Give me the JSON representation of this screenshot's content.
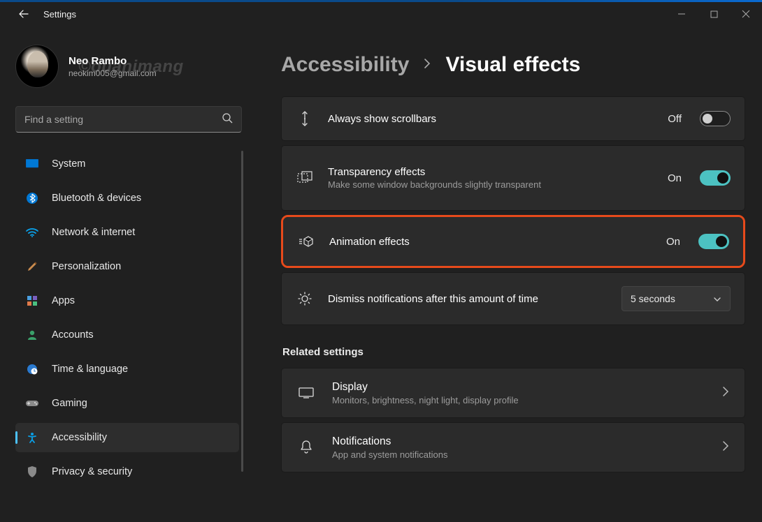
{
  "window": {
    "app_title": "Settings"
  },
  "profile": {
    "name": "Neo Rambo",
    "email": "neokim005@gmail.com",
    "watermark": "©ouanimang"
  },
  "search": {
    "placeholder": "Find a setting"
  },
  "nav": [
    {
      "icon": "system",
      "label": "System"
    },
    {
      "icon": "bluetooth",
      "label": "Bluetooth & devices"
    },
    {
      "icon": "wifi",
      "label": "Network & internet"
    },
    {
      "icon": "brush",
      "label": "Personalization"
    },
    {
      "icon": "apps",
      "label": "Apps"
    },
    {
      "icon": "account",
      "label": "Accounts"
    },
    {
      "icon": "time",
      "label": "Time & language"
    },
    {
      "icon": "gaming",
      "label": "Gaming"
    },
    {
      "icon": "accessibility",
      "label": "Accessibility"
    },
    {
      "icon": "privacy",
      "label": "Privacy & security"
    }
  ],
  "nav_selected_index": 8,
  "breadcrumb": {
    "parent": "Accessibility",
    "current": "Visual effects"
  },
  "settings": {
    "scrollbars": {
      "title": "Always show scrollbars",
      "state_label": "Off",
      "on": false
    },
    "transparency": {
      "title": "Transparency effects",
      "desc": "Make some window backgrounds slightly transparent",
      "state_label": "On",
      "on": true
    },
    "animation": {
      "title": "Animation effects",
      "state_label": "On",
      "on": true
    },
    "dismiss": {
      "title": "Dismiss notifications after this amount of time",
      "value": "5 seconds"
    }
  },
  "related": {
    "heading": "Related settings",
    "display": {
      "title": "Display",
      "desc": "Monitors, brightness, night light, display profile"
    },
    "notifications": {
      "title": "Notifications",
      "desc": "App and system notifications"
    }
  }
}
